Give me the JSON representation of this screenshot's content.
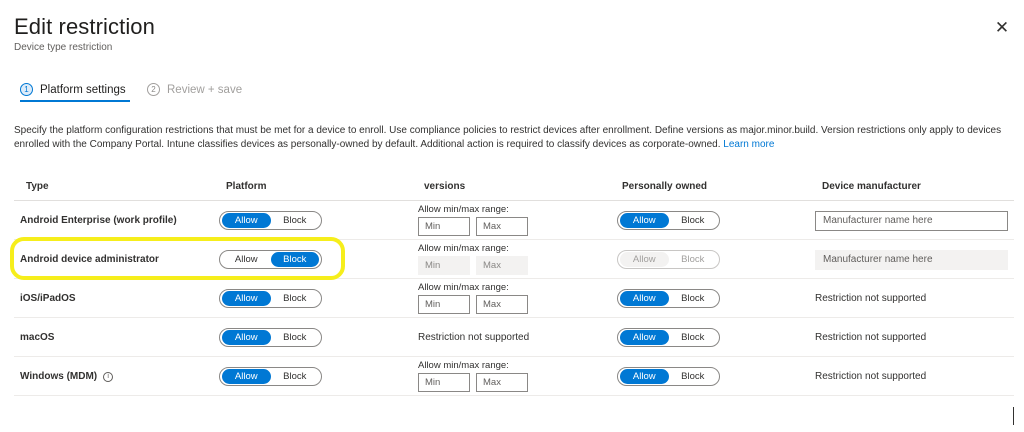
{
  "header": {
    "title": "Edit restriction",
    "subtitle": "Device type restriction",
    "close_glyph": "✕"
  },
  "steps": [
    {
      "number": "1",
      "label": "Platform settings",
      "active": true
    },
    {
      "number": "2",
      "label": "Review + save",
      "active": false
    }
  ],
  "description": {
    "text": "Specify the platform configuration restrictions that must be met for a device to enroll. Use compliance policies to restrict devices after enrollment. Define versions as major.minor.build. Version restrictions only apply to devices enrolled with the Company Portal. Intune classifies devices as personally-owned by default. Additional action is required to classify devices as corporate-owned.",
    "link": "Learn more"
  },
  "table": {
    "columns": [
      "Type",
      "Platform",
      "versions",
      "Personally owned",
      "Device manufacturer"
    ],
    "rows": [
      {
        "type": "Android Enterprise (work profile)",
        "platform": {
          "allow": "Allow",
          "block": "Block",
          "selected": "Allow"
        },
        "versions": {
          "label": "Allow min/max range:",
          "min_placeholder": "Min",
          "max_placeholder": "Max",
          "disabled": false
        },
        "owned": {
          "allow": "Allow",
          "block": "Block",
          "selected": "Allow",
          "disabled": false
        },
        "manufacturer": {
          "placeholder": "Manufacturer name here",
          "disabled": false
        }
      },
      {
        "type": "Android device administrator",
        "platform": {
          "allow": "Allow",
          "block": "Block",
          "selected": "Block"
        },
        "versions": {
          "label": "Allow min/max range:",
          "min_placeholder": "Min",
          "max_placeholder": "Max",
          "disabled": true
        },
        "owned": {
          "allow": "Allow",
          "block": "Block",
          "selected": "Allow",
          "disabled": true
        },
        "manufacturer": {
          "placeholder": "Manufacturer name here",
          "disabled": true
        }
      },
      {
        "type": "iOS/iPadOS",
        "platform": {
          "allow": "Allow",
          "block": "Block",
          "selected": "Allow"
        },
        "versions": {
          "label": "Allow min/max range:",
          "min_placeholder": "Min",
          "max_placeholder": "Max",
          "disabled": false
        },
        "owned": {
          "allow": "Allow",
          "block": "Block",
          "selected": "Allow",
          "disabled": false
        },
        "manufacturer_text": "Restriction not supported"
      },
      {
        "type": "macOS",
        "platform": {
          "allow": "Allow",
          "block": "Block",
          "selected": "Allow"
        },
        "versions_text": "Restriction not supported",
        "owned": {
          "allow": "Allow",
          "block": "Block",
          "selected": "Allow",
          "disabled": false
        },
        "manufacturer_text": "Restriction not supported"
      },
      {
        "type": "Windows (MDM)",
        "info_glyph": "i",
        "platform": {
          "allow": "Allow",
          "block": "Block",
          "selected": "Allow"
        },
        "versions": {
          "label": "Allow min/max range:",
          "min_placeholder": "Min",
          "max_placeholder": "Max",
          "disabled": false
        },
        "owned": {
          "allow": "Allow",
          "block": "Block",
          "selected": "Allow",
          "disabled": false
        },
        "manufacturer_text": "Restriction not supported"
      }
    ]
  },
  "colors": {
    "accent": "#0078d4",
    "highlight": "#f6ee1b",
    "disabled_bg": "#f3f2f1"
  }
}
